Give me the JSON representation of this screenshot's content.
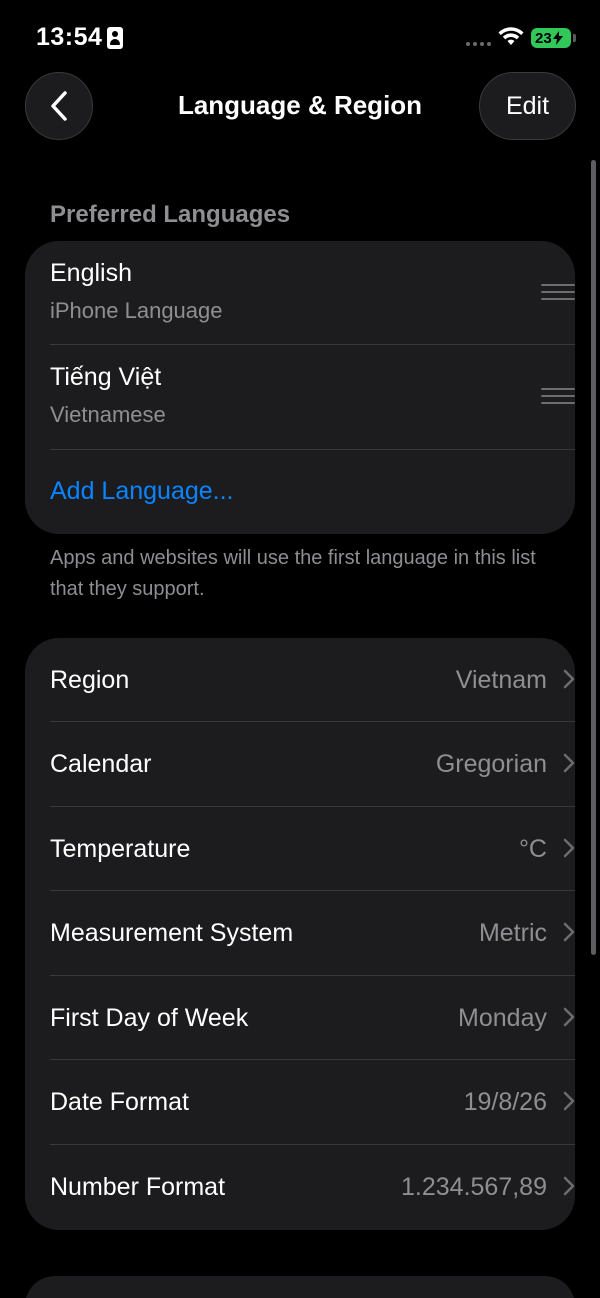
{
  "status": {
    "time": "13:54",
    "battery": "23"
  },
  "nav": {
    "title": "Language & Region",
    "edit_label": "Edit"
  },
  "preferred": {
    "header": "Preferred Languages",
    "languages": [
      {
        "name": "English",
        "subtitle": "iPhone Language"
      },
      {
        "name": "Tiếng Việt",
        "subtitle": "Vietnamese"
      }
    ],
    "add_label": "Add Language...",
    "footer": "Apps and websites will use the first language in this list that they support."
  },
  "settings": [
    {
      "label": "Region",
      "value": "Vietnam"
    },
    {
      "label": "Calendar",
      "value": "Gregorian"
    },
    {
      "label": "Temperature",
      "value": "°C"
    },
    {
      "label": "Measurement System",
      "value": "Metric"
    },
    {
      "label": "First Day of Week",
      "value": "Monday"
    },
    {
      "label": "Date Format",
      "value": "19/8/26"
    },
    {
      "label": "Number Format",
      "value": "1.234.567,89"
    }
  ],
  "colors": {
    "accent": "#0a84ff",
    "battery": "#32c759",
    "group_bg": "#1c1c1e",
    "secondary_text": "#8e8e93"
  }
}
